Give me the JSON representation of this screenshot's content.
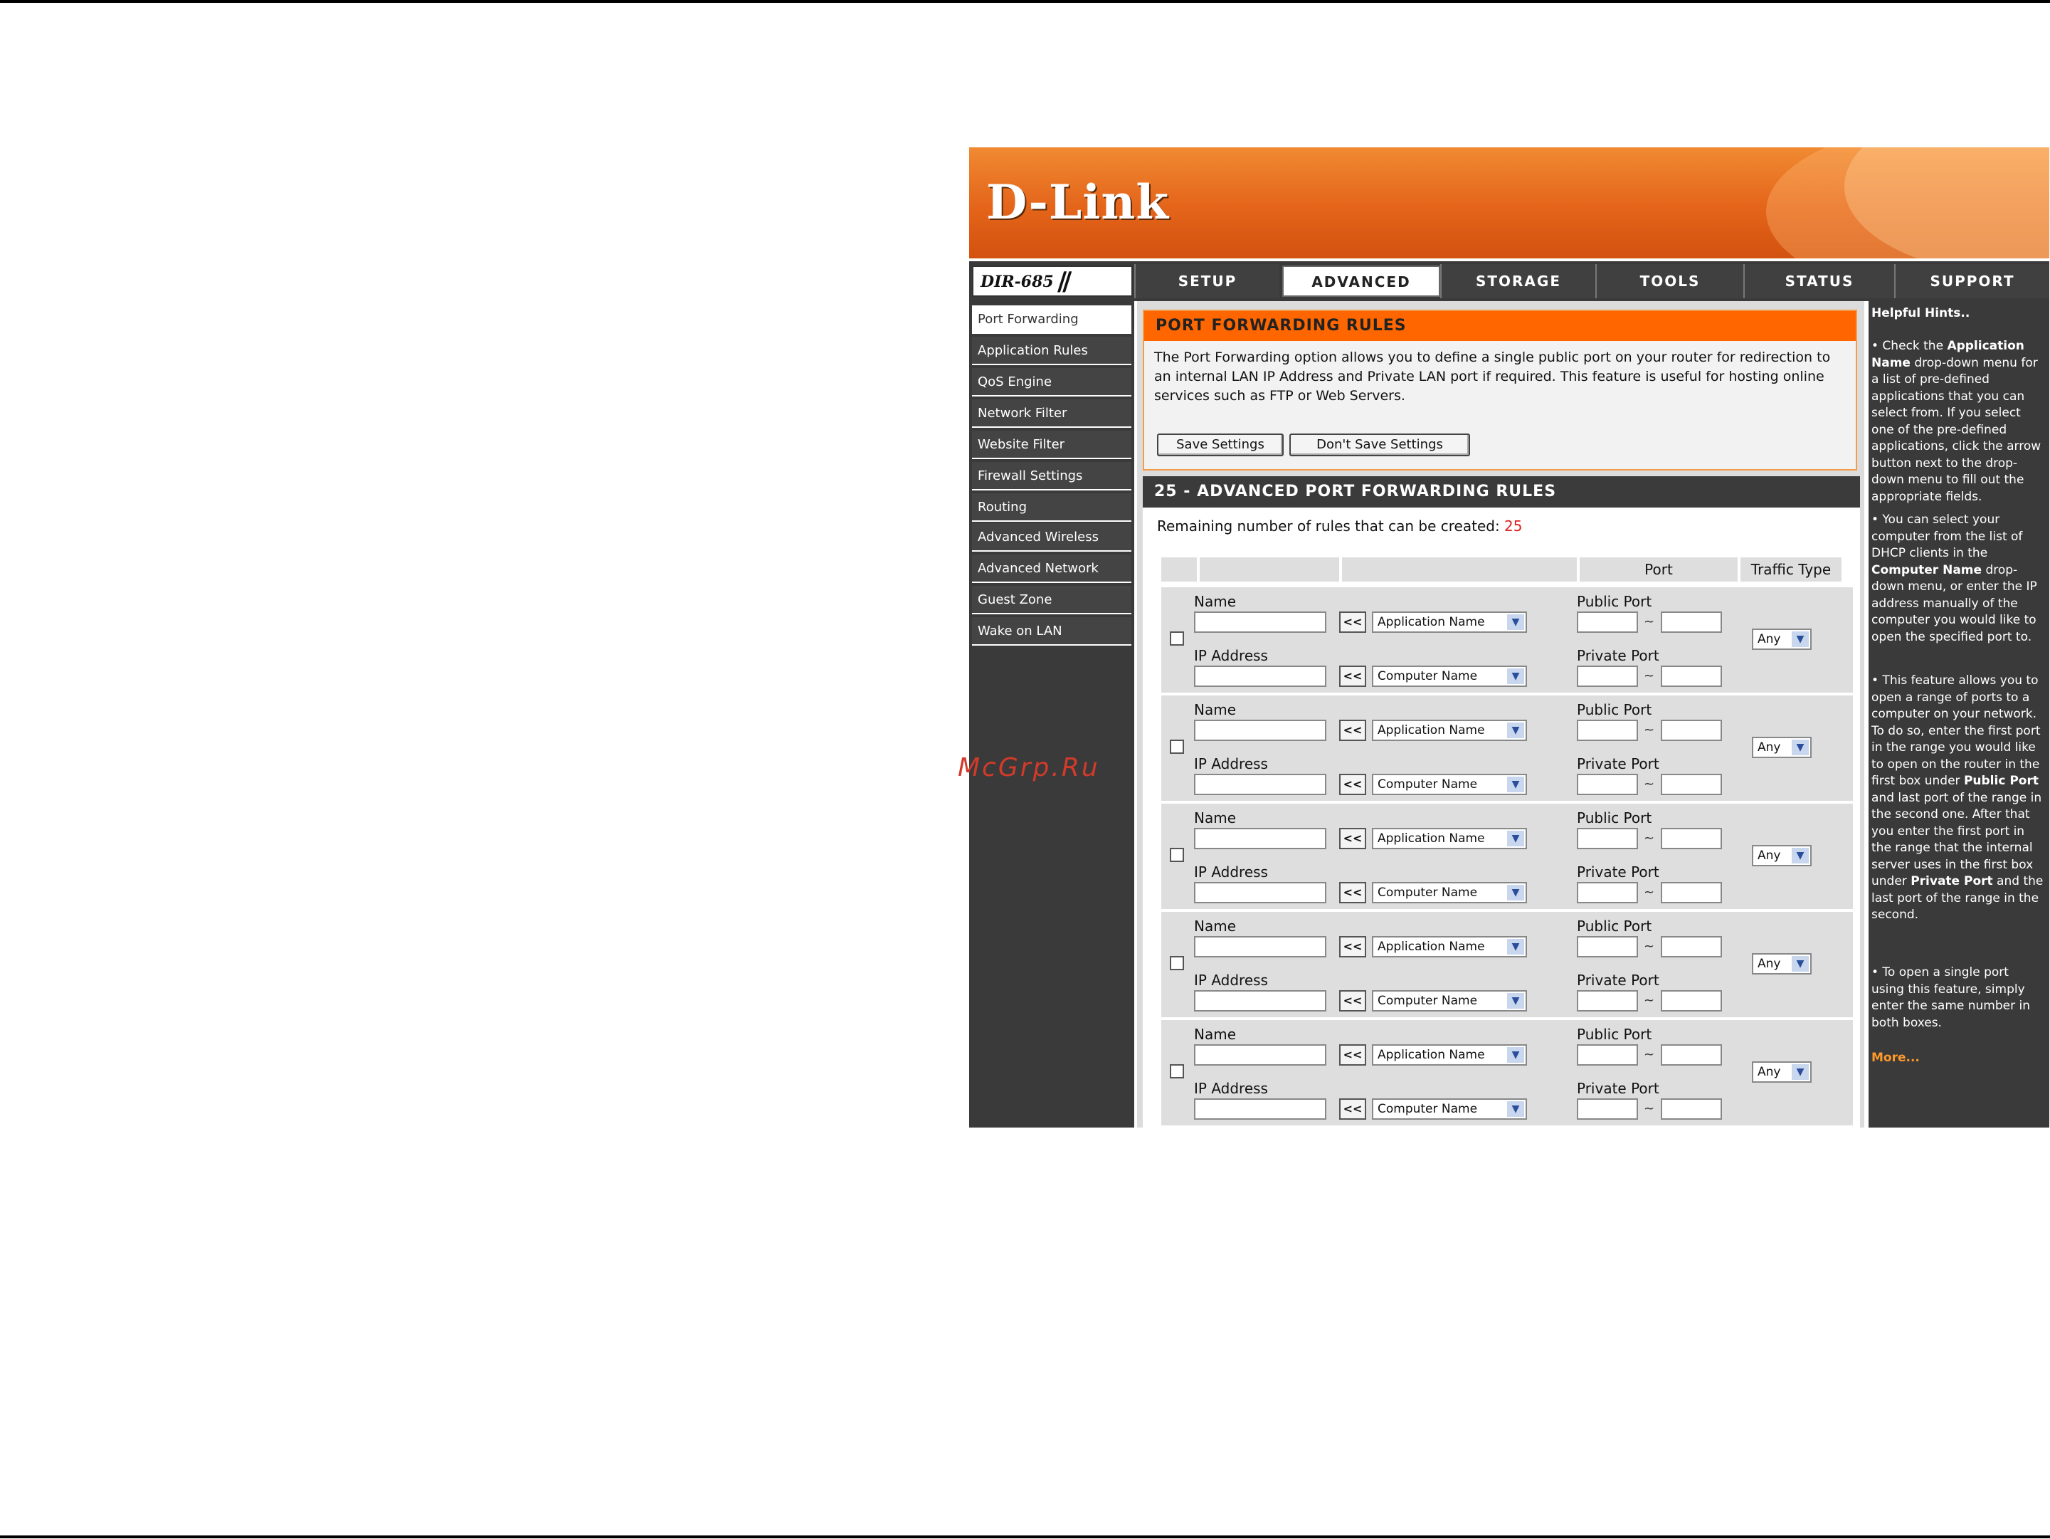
{
  "brand": {
    "logo": "D-Link",
    "model": "DIR-685",
    "colors": {
      "orange": "#ff6600",
      "dark": "#3a3a3a"
    }
  },
  "nav": {
    "tabs": [
      "SETUP",
      "ADVANCED",
      "STORAGE",
      "TOOLS",
      "STATUS",
      "SUPPORT"
    ],
    "active": "ADVANCED"
  },
  "sidebar": {
    "items": [
      "Port Forwarding",
      "Application Rules",
      "QoS Engine",
      "Network Filter",
      "Website Filter",
      "Firewall Settings",
      "Routing",
      "Advanced Wireless",
      "Advanced Network",
      "Guest Zone",
      "Wake on LAN"
    ],
    "active": "Port Forwarding"
  },
  "section1": {
    "title": "PORT FORWARDING RULES",
    "desc": "The Port Forwarding option allows you to define a single public port on your router for redirection to an internal LAN IP Address and Private LAN port if required. This feature is useful for hosting online services such as FTP or Web Servers.",
    "save": "Save Settings",
    "dont_save": "Don't Save Settings"
  },
  "section2": {
    "title": "25 - ADVANCED PORT FORWARDING RULES",
    "remaining_label": "Remaining number of rules that can be created:",
    "remaining_value": "25",
    "col_port": "Port",
    "col_traffic": "Traffic Type"
  },
  "row_labels": {
    "name": "Name",
    "ip": "IP Address",
    "public_port": "Public Port",
    "private_port": "Private Port",
    "copy_btn": "<<",
    "app_select": "Application Name",
    "computer_select": "Computer Name",
    "tilde": "~",
    "traffic": "Any"
  },
  "hints": {
    "title": "Helpful Hints..",
    "h1_a": "• Check the ",
    "h1_b": "Application Name",
    "h1_c": " drop-down menu for a list of pre-defined applications that you can select from. If you select one of the pre-defined applications, click the arrow button next to the drop-down menu to fill out the appropriate fields.",
    "h2_a": "• You can select your computer from the list of DHCP clients in the ",
    "h2_b": "Computer Name",
    "h2_c": " drop-down menu, or enter the IP address manually of the computer you would like to open the specified port to.",
    "h3_a": "• This feature allows you to open a range of ports to a computer on your network. To do so, enter the first port in the range you would like to open on the router in the first box under ",
    "h3_b": "Public Port",
    "h3_c": " and last port of the range in the second one. After that you enter the first port in the range that the internal server uses in the first box under ",
    "h3_d": "Private Port",
    "h3_e": " and the last port of the range in the second.",
    "h4": "• To open a single port using this feature, simply enter the same number in both boxes.",
    "more": "More..."
  },
  "watermark": "McGrp.Ru"
}
